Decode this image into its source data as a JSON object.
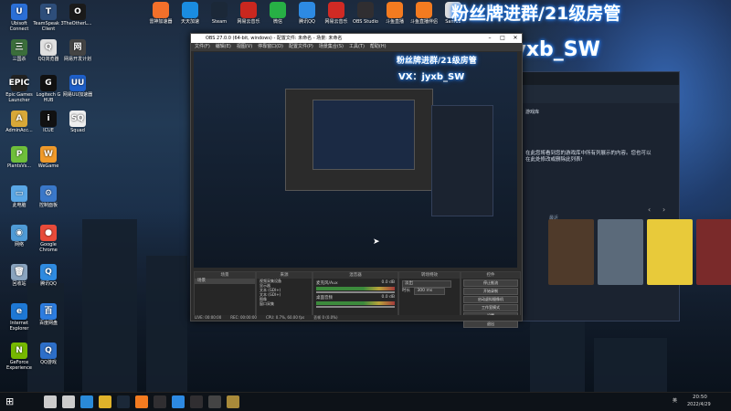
{
  "desktop_icons": [
    {
      "label": "Ubisoft Connect",
      "color": "#2b6fd6",
      "glyph": "U"
    },
    {
      "label": "TeamSpeak 3 Client",
      "color": "#2e4e7a",
      "glyph": "T"
    },
    {
      "label": "TheOtherL...",
      "color": "#1a1a1a",
      "glyph": "O"
    },
    {
      "label": "三国杀",
      "color": "#3b6e3b",
      "glyph": "三"
    },
    {
      "label": "QQ浏览器",
      "color": "#e0e0e0",
      "glyph": "Q"
    },
    {
      "label": "网易开发计划",
      "color": "#444",
      "glyph": "网"
    },
    {
      "label": "Epic Games Launcher",
      "color": "#222",
      "glyph": "EPIC"
    },
    {
      "label": "Logitech G HUB",
      "color": "#111",
      "glyph": "G"
    },
    {
      "label": "网易UU加速器",
      "color": "#1e5fc9",
      "glyph": "UU"
    },
    {
      "label": "AdminAcc...",
      "color": "#d8a838",
      "glyph": "A"
    },
    {
      "label": "ICUE",
      "color": "#111",
      "glyph": "i"
    },
    {
      "label": "Squad",
      "color": "#eee",
      "glyph": "SQ"
    },
    {
      "label": "PlantsVs...",
      "color": "#6fbf3a",
      "glyph": "P"
    },
    {
      "label": "WeGame",
      "color": "#f09a2a",
      "glyph": "W"
    },
    {
      "label": "此电脑",
      "color": "#5aa7e6",
      "glyph": "▭"
    },
    {
      "label": "控制面板",
      "color": "#3a78c9",
      "glyph": "⚙"
    },
    {
      "label": "网络",
      "color": "#4f9bd6",
      "glyph": "◉"
    },
    {
      "label": "Google Chrome",
      "color": "#e84b3a",
      "glyph": "●"
    },
    {
      "label": "回收站",
      "color": "#8aa4bf",
      "glyph": "🗑"
    },
    {
      "label": "腾讯QQ",
      "color": "#2f8be0",
      "glyph": "Q"
    },
    {
      "label": "Internet Explorer",
      "color": "#1e78d4",
      "glyph": "e"
    },
    {
      "label": "百度网盘",
      "color": "#2d7de0",
      "glyph": "百"
    },
    {
      "label": "GeForce Experience",
      "color": "#76b900",
      "glyph": "N"
    },
    {
      "label": "QQ游戏",
      "color": "#2d6fc9",
      "glyph": "Q"
    }
  ],
  "top_icons": [
    {
      "label": "雷神加速器",
      "color": "#f3702a"
    },
    {
      "label": "天天加速",
      "color": "#1a8ce0"
    },
    {
      "label": "Steam",
      "color": "#1b2838"
    },
    {
      "label": "网易云音乐",
      "color": "#c9271f"
    },
    {
      "label": "微信",
      "color": "#27b045"
    },
    {
      "label": "腾讯QQ",
      "color": "#2d8ae3"
    },
    {
      "label": "网易云音乐",
      "color": "#d02a24"
    },
    {
      "label": "OBS Studio",
      "color": "#302e31"
    },
    {
      "label": "斗鱼直播",
      "color": "#f47b20"
    },
    {
      "label": "斗鱼直播伴侣",
      "color": "#f47b20"
    },
    {
      "label": "Sam12",
      "color": "#ddd"
    }
  ],
  "watermark": {
    "line1": "粉丝牌进群/21级房管",
    "line2": "VX：jyxb_SW"
  },
  "obs": {
    "title": "OBS 27.0.0 (64-bit, windows) - 配置文件: 未命名 - 场景: 未命名",
    "menu": [
      "文件(F)",
      "编辑(E)",
      "视图(V)",
      "停靠窗口(D)",
      "配置文件(P)",
      "场景集合(S)",
      "工具(T)",
      "帮助(H)"
    ],
    "preview_wm_line1": "粉丝牌进群/21级房管",
    "preview_wm_line2": "VX：jyxb_SW",
    "scenes_header": "场景",
    "sources_header": "来源",
    "mixer_header": "混音器",
    "transitions_header": "转场特效",
    "controls_header": "控件",
    "scene_items": [
      "场景"
    ],
    "source_items": [
      "视频采集设备",
      "显示器",
      "文本 (GDI+)",
      "文本 (GDI+)",
      "图像",
      "窗口采集"
    ],
    "mixer_items": [
      {
        "name": "麦克风/Aux",
        "value": "0.0 dB"
      },
      {
        "name": "桌面音频",
        "value": "0.0 dB"
      }
    ],
    "transition": "淡出",
    "duration_label": "时长",
    "duration": "300 ms",
    "control_buttons": [
      "停止推流",
      "开始录制",
      "启动虚拟摄像机",
      "工作室模式",
      "设置",
      "退出"
    ],
    "status_live": "LIVE: 00:00:00",
    "status_rec": "REC: 00:00:00",
    "status_cpu": "CPU: 0.7%, 60.00 fps",
    "status_drop": "丢帧 0 (0.0%)"
  },
  "steam": {
    "text1": "游戏库",
    "text2": "在此您将看到您的游戏库中所有列展示的内容。您也可以在此处修改或删除此列表!",
    "text3": "最近",
    "card_colors": [
      "#4f3a2a",
      "#5b6a7a",
      "#e8ca3a",
      "#7a2a2a"
    ]
  },
  "taskbar": {
    "time": "20:50",
    "date": "2022/4/29",
    "lang": "英",
    "icons": [
      "start-icon",
      "search-icon",
      "task-view-icon",
      "edge-icon",
      "file-explorer-icon",
      "steam-icon",
      "douyu-icon",
      "obs-icon",
      "qq-icon",
      "obs-icon",
      "camera-icon",
      "lol-icon"
    ]
  }
}
